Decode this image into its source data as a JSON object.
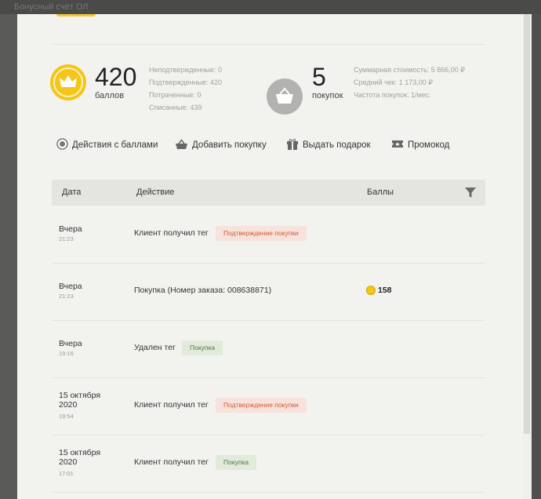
{
  "backdrop_title": "Бонусный счёт ОЛ",
  "stats": {
    "points_value": "420",
    "points_label": "баллов",
    "points_details": [
      "Неподтвержденные: 0",
      "Подтвержденные: 420",
      "Потраченные: 0",
      "Списанные: 439"
    ],
    "purchases_value": "5",
    "purchases_label": "покупок",
    "purchase_details": [
      "Суммарная стоимость: 5 866,00 ₽",
      "Средний чек: 1 173,00 ₽",
      "Частота покупок: 1/мес."
    ]
  },
  "actions": [
    {
      "label": "Действия с баллами",
      "icon": "coin-icon"
    },
    {
      "label": "Добавить покупку",
      "icon": "basket-icon"
    },
    {
      "label": "Выдать подарок",
      "icon": "gift-icon"
    },
    {
      "label": "Промокод",
      "icon": "ticket-icon"
    }
  ],
  "table": {
    "columns": [
      "Дата",
      "Действие",
      "Баллы"
    ],
    "rows": [
      {
        "date": "Вчера",
        "time": "21:23",
        "action": "Клиент получил тег",
        "tag": "Подтверждение покупки",
        "tag_color": "#d0593a",
        "points": ""
      },
      {
        "date": "Вчера",
        "time": "21:23",
        "action": "Покупка (Номер заказа: 008638871)",
        "tag": "",
        "points": "158"
      },
      {
        "date": "Вчера",
        "time": "19:16",
        "action": "Удален тег",
        "tag": "Покупка",
        "tag_color": "#4e7a44",
        "points": ""
      },
      {
        "date_line1": "15 октября",
        "date_line2": "2020",
        "time": "19:54",
        "action": "Клиент получил тег",
        "tag": "Подтверждение покупки",
        "tag_color": "#d0593a",
        "points": ""
      },
      {
        "date_line1": "15 октября",
        "date_line2": "2020",
        "time": "17:01",
        "action": "Клиент получил тег",
        "tag": "Покупка",
        "tag_color": "#4e7a44",
        "points": ""
      }
    ]
  },
  "colors": {
    "gold": "#f5c518",
    "grey_circle": "#b2b2b0",
    "header_bg": "#e5e5df"
  }
}
